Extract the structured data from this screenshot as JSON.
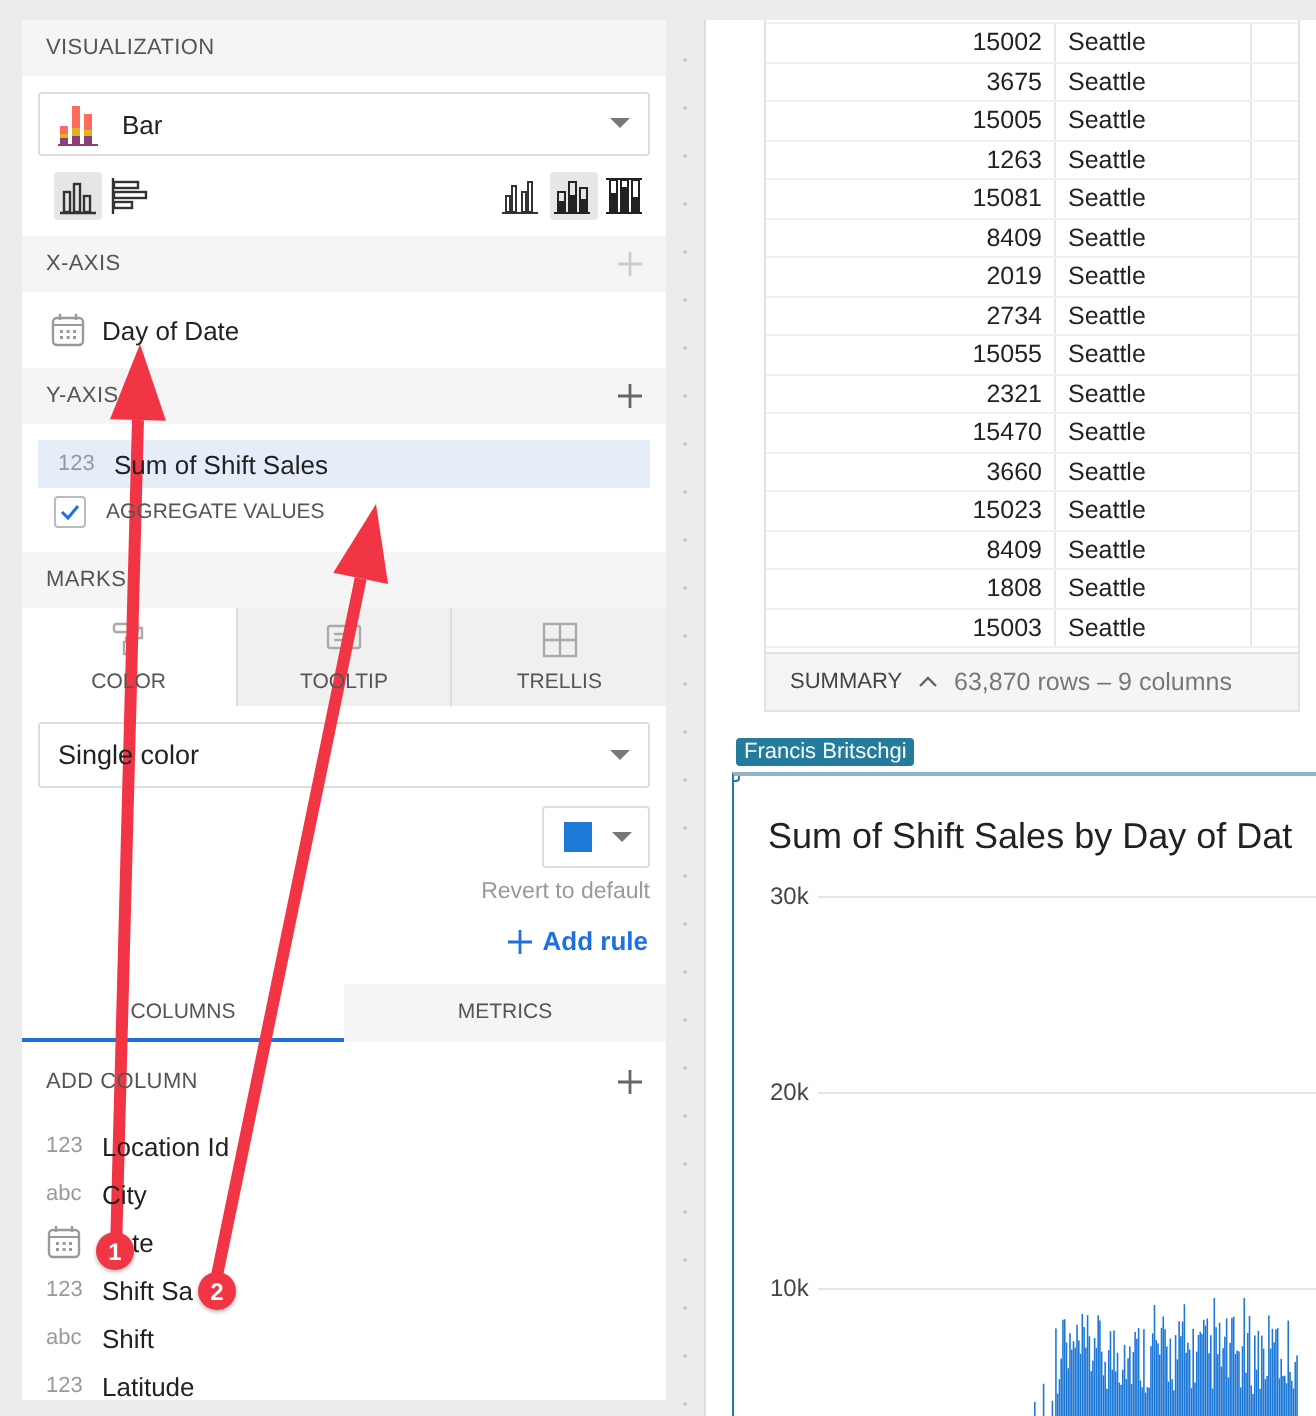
{
  "visualization": {
    "title": "VISUALIZATION",
    "chart_type": "Bar",
    "orientations": [
      {
        "kind": "vertical",
        "selected": true
      },
      {
        "kind": "horizontal",
        "selected": false
      }
    ],
    "layouts": [
      {
        "kind": "grouped",
        "selected": false
      },
      {
        "kind": "stacked",
        "selected": true
      },
      {
        "kind": "full",
        "selected": false
      }
    ]
  },
  "x_axis": {
    "title": "X-AXIS",
    "field": {
      "kind": "date",
      "label": "Day of Date"
    }
  },
  "y_axis": {
    "title": "Y-AXIS",
    "field": {
      "kind": "number",
      "type_label": "123",
      "label": "Sum of Shift Sales",
      "selected": true
    },
    "aggregate": {
      "label": "AGGREGATE VALUES",
      "checked": true
    }
  },
  "marks": {
    "title": "MARKS",
    "tabs": [
      {
        "kind": "color",
        "label": "COLOR",
        "selected": true
      },
      {
        "kind": "tooltip",
        "label": "TOOLTIP",
        "selected": false
      },
      {
        "kind": "trellis",
        "label": "TRELLIS",
        "selected": false
      }
    ],
    "color_mode": "Single color",
    "swatch": {
      "color": "#1e78d8"
    },
    "revert": "Revert to default",
    "add_rule": "Add rule"
  },
  "panel_tabs": [
    {
      "label": "COLUMNS",
      "selected": true
    },
    {
      "label": "METRICS",
      "selected": false
    }
  ],
  "add_column": "ADD COLUMN",
  "columns": [
    {
      "kind": "number",
      "type_label": "123",
      "label": "Location Id"
    },
    {
      "kind": "text",
      "type_label": "abc",
      "label": "City"
    },
    {
      "kind": "date",
      "label": "te"
    },
    {
      "kind": "number",
      "type_label": "123",
      "label": "Shift Sa"
    },
    {
      "kind": "text",
      "type_label": "abc",
      "label": "Shift"
    },
    {
      "kind": "number",
      "type_label": "123",
      "label": "Latitude"
    }
  ],
  "table": {
    "rows": [
      [
        "15002",
        "Seattle"
      ],
      [
        "3675",
        "Seattle"
      ],
      [
        "15005",
        "Seattle"
      ],
      [
        "1263",
        "Seattle"
      ],
      [
        "15081",
        "Seattle"
      ],
      [
        "8409",
        "Seattle"
      ],
      [
        "2019",
        "Seattle"
      ],
      [
        "2734",
        "Seattle"
      ],
      [
        "15055",
        "Seattle"
      ],
      [
        "2321",
        "Seattle"
      ],
      [
        "15470",
        "Seattle"
      ],
      [
        "3660",
        "Seattle"
      ],
      [
        "15023",
        "Seattle"
      ],
      [
        "8409",
        "Seattle"
      ],
      [
        "1808",
        "Seattle"
      ],
      [
        "15003",
        "Seattle"
      ]
    ],
    "summary": {
      "label": "SUMMARY",
      "info": "63,870 rows – 9 columns"
    }
  },
  "chart": {
    "owner": "Francis Britschgi",
    "title": "Sum of Shift Sales by Day of Dat",
    "yticks": [
      "30k",
      "20k",
      "10k"
    ]
  },
  "annotations": [
    {
      "label": "1"
    },
    {
      "label": "2"
    }
  ]
}
